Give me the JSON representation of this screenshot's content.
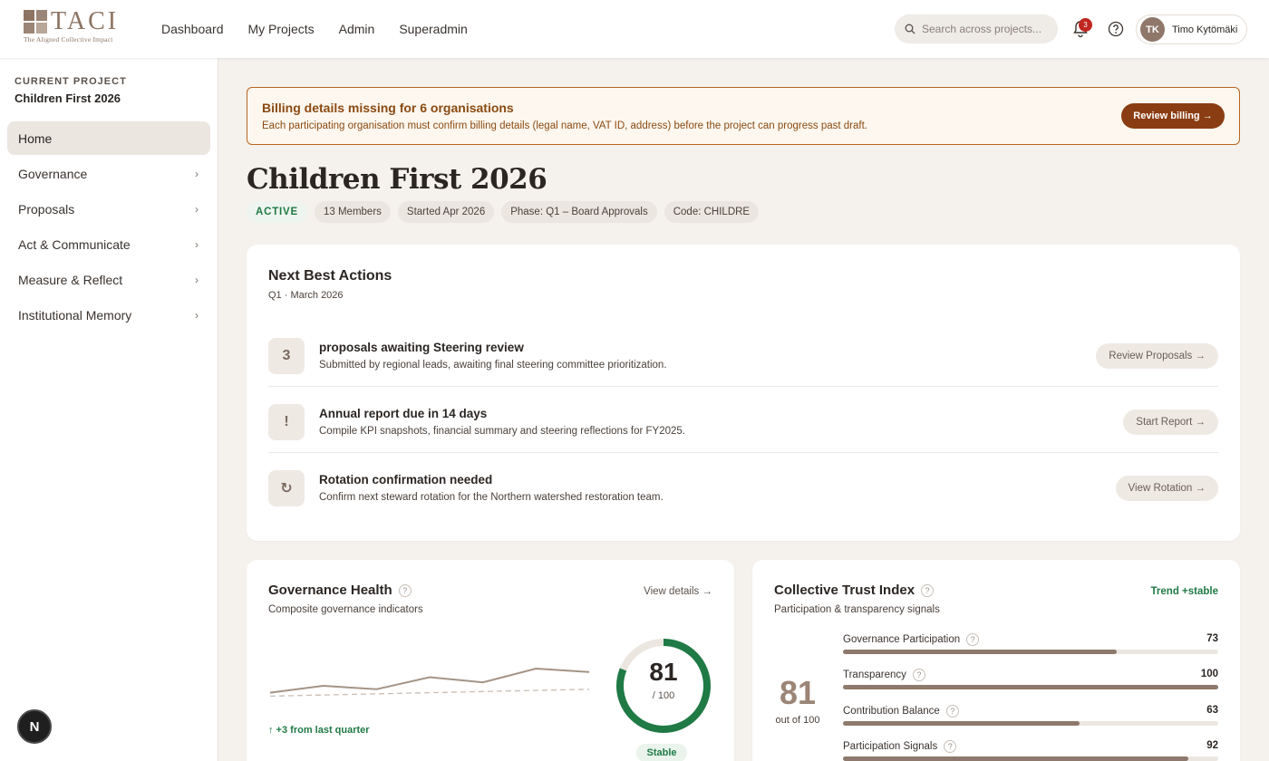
{
  "brand": {
    "name": "TACI",
    "tagline": "The Aligned Collective Impact"
  },
  "nav": [
    {
      "label": "Dashboard"
    },
    {
      "label": "My Projects"
    },
    {
      "label": "Admin"
    },
    {
      "label": "Superadmin"
    }
  ],
  "search": {
    "placeholder": "Search across projects..."
  },
  "notifications": {
    "count": "3"
  },
  "user": {
    "initials": "TK",
    "name": "Timo Kytömäki"
  },
  "sidebar": {
    "current_label": "CURRENT PROJECT",
    "current_project": "Children First 2026",
    "items": [
      {
        "label": "Home",
        "active": true
      },
      {
        "label": "Governance"
      },
      {
        "label": "Proposals"
      },
      {
        "label": "Act & Communicate"
      },
      {
        "label": "Measure & Reflect"
      },
      {
        "label": "Institutional Memory"
      }
    ]
  },
  "floating_badge": "N",
  "banner": {
    "title": "Billing details missing for 6 organisations",
    "text": "Each participating organisation must confirm billing details (legal name, VAT ID, address) before the project can progress past draft.",
    "button": "Review billing →"
  },
  "project": {
    "title": "Children First 2026",
    "status": "ACTIVE",
    "tags": [
      "13 Members",
      "Started Apr 2026",
      "Phase: Q1 – Board Approvals",
      "Code: CHILDRE"
    ]
  },
  "next_actions": {
    "title": "Next Best Actions",
    "subtitle": "Q1 · March 2026",
    "items": [
      {
        "icon": "3",
        "title": "proposals awaiting Steering review",
        "desc": "Submitted by regional leads, awaiting final steering committee prioritization.",
        "button": "Review Proposals →"
      },
      {
        "icon": "!",
        "title": "Annual report due in 14 days",
        "desc": "Compile KPI snapshots, financial summary and steering reflections for FY2025.",
        "button": "Start Report →"
      },
      {
        "icon": "↻",
        "title": "Rotation confirmation needed",
        "desc": "Confirm next steward rotation for the Northern watershed restoration team.",
        "button": "View Rotation →"
      }
    ]
  },
  "governance_health": {
    "title": "Governance Health",
    "help": "?",
    "subtitle": "Composite governance indicators",
    "link": "View details →",
    "delta": "↑ +3 from last quarter",
    "score": "81",
    "max": "/ 100",
    "score_fraction": 0.81,
    "state": "Stable",
    "trend": [
      0.3,
      0.5,
      0.4,
      0.75,
      0.6,
      1.0,
      0.9
    ],
    "baseline": [
      0.2,
      0.4
    ]
  },
  "trust_index": {
    "title": "Collective Trust Index",
    "help": "?",
    "subtitle": "Participation & transparency signals",
    "trend": "Trend +stable",
    "score": "81",
    "score_sub": "out of 100",
    "metrics": [
      {
        "label": "Governance Participation",
        "value": "73",
        "fraction": 0.73
      },
      {
        "label": "Transparency",
        "value": "100",
        "fraction": 1.0
      },
      {
        "label": "Contribution Balance",
        "value": "63",
        "fraction": 0.63
      },
      {
        "label": "Participation Signals",
        "value": "92",
        "fraction": 0.92
      }
    ]
  },
  "colors": {
    "accent": "#8a3d12",
    "brand": "#8c7362",
    "success": "#1f7a45",
    "badge": "#c0261f"
  }
}
